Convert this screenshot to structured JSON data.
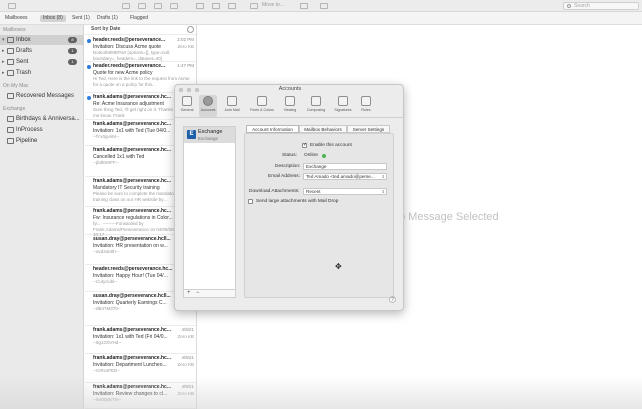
{
  "toolbar": {
    "items": [
      "",
      "",
      "",
      "",
      "",
      "",
      "",
      "Move to...",
      ""
    ],
    "search_placeholder": "Search"
  },
  "favorites": {
    "mailboxes": "Mailboxes",
    "inbox": "Inbox (8)",
    "sent": "Sent (1)",
    "drafts": "Drafts (1)",
    "flagged": "Flagged"
  },
  "sidebar": {
    "section_mailboxes": "Mailboxes",
    "items": [
      {
        "label": "Inbox",
        "badge": "8"
      },
      {
        "label": "Drafts",
        "badge": "1"
      },
      {
        "label": "Sent",
        "badge": "1"
      },
      {
        "label": "Trash",
        "badge": ""
      },
      {
        "label": "Recovered Messages",
        "badge": ""
      }
    ],
    "section_on_my_mac": "On My Mac",
    "section_exchange": "Exchange",
    "exchange_items": [
      {
        "label": "Birthdays & Anniversa..."
      },
      {
        "label": "InProcess"
      },
      {
        "label": "Pipeline"
      }
    ]
  },
  "message_list": {
    "sort_label": "Sort by Date",
    "messages": [
      {
        "from": "header.reeds@perseverance...",
        "date": "2:02 PM",
        "subject": "Invitation: Discuss Acme quote",
        "attachment": "Zero KB",
        "snippet": "NoteofMIMEPart [options=[], type=null, boundary=, headers=, dataset=40]",
        "unread": true
      },
      {
        "from": "header.reeds@perseverance...",
        "date": "1:47 PM",
        "subject": "Quote for new Acme policy",
        "attachment": "",
        "snippet": "Hi Ted, Here is the link to the request from Acme for a quote on a policy for this...",
        "unread": true
      },
      {
        "from": "frank.adams@perseverance.hc...",
        "date": "",
        "subject": "Re: Acme Insurance adjustment",
        "attachment": "",
        "snippet": "Sure thing Ted, I'll get right on it. Thanks for letting me know. Frank",
        "unread": true
      },
      {
        "from": "frank.adams@perseverance.hc...",
        "date": "",
        "subject": "Invitation: 1x1 with Ted (Tue 04/0...",
        "attachment": "",
        "snippet": "--fYx0gvnM--",
        "unread": false
      },
      {
        "from": "frank.adams@perseverance.hc...",
        "date": "",
        "subject": "Cancelled 1x1 with Ted",
        "attachment": "",
        "snippet": "--jbdEMrFF--",
        "unread": false
      },
      {
        "from": "frank.adams@perseverance.hc...",
        "date": "",
        "subject": "Mandatory IT Security training",
        "attachment": "",
        "snippet": "Please be sure to complete the mandatory IT training class on our HR website by...",
        "unread": false
      },
      {
        "from": "frank.adams@perseverance.hc...",
        "date": "",
        "subject": "Fw: Insurance regulations in Color...",
        "attachment": "",
        "snippet": "fyi... ---------Forwarded by Frank.Adams/Perseverance on 04/09/2021 10:17...",
        "unread": false
      },
      {
        "from": "susan.dray@perseverance.hcll...",
        "date": "",
        "subject": "Invitation: HR presentation on w...",
        "attachment": "",
        "snippet": "--avd2ub0h--",
        "unread": false
      },
      {
        "from": "header.reeds@perseverance.hc...",
        "date": "",
        "subject": "Invitation: Happy Hour! (Tue 04/...",
        "attachment": "",
        "snippet": "--CuIyAobl--",
        "unread": false
      },
      {
        "from": "susan.dray@perseverance.hcll...",
        "date": "",
        "subject": "Invitation: Quarterly Earnings C...",
        "attachment": "",
        "snippet": "--dB47M370--",
        "unread": false
      },
      {
        "from": "frank.adams@perseverance.hc...",
        "date": "4/9/21",
        "subject": "Invitation: 1x1 with Ted (Fri 04/0...",
        "attachment": "Zero KB",
        "snippet": "--8g1G0VHd--",
        "unread": false
      },
      {
        "from": "frank.adams@perseverance.hc...",
        "date": "4/9/21",
        "subject": "Invitation: Department Luncheo...",
        "attachment": "Zero KB",
        "snippet": "--CIRcsFED--",
        "unread": false
      },
      {
        "from": "frank.adams@perseverance.hc...",
        "date": "4/9/21",
        "subject": "Invitation: Review changes to cl...",
        "attachment": "Zero KB",
        "snippet": "--5n0DyETm--",
        "unread": false
      }
    ]
  },
  "reading_pane": {
    "empty_text": "o Message Selected"
  },
  "accounts_window": {
    "title": "Accounts",
    "toolbar": [
      {
        "label": "General",
        "icon": "switch-icon"
      },
      {
        "label": "Accounts",
        "icon": "at-sign-icon"
      },
      {
        "label": "Junk Mail",
        "icon": "trash-junk-icon"
      },
      {
        "label": "Fonts & Colors",
        "icon": "font-icon"
      },
      {
        "label": "Viewing",
        "icon": "glasses-icon"
      },
      {
        "label": "Composing",
        "icon": "pen-icon"
      },
      {
        "label": "Signatures",
        "icon": "signature-icon"
      },
      {
        "label": "Rules",
        "icon": "rules-icon"
      }
    ],
    "account": {
      "name": "Exchange",
      "type": "Exchange",
      "icon_letter": "E"
    },
    "tabs": [
      "Account Information",
      "Mailbox Behaviors",
      "Server Settings"
    ],
    "enable_label": "Enable this account",
    "status_label": "Status:",
    "status_value": "Online",
    "description_label": "Description:",
    "description_value": "Exchange",
    "email_label": "Email Address:",
    "email_value": "Ted Amado <ted.amado@perse...",
    "download_label": "Download Attachments:",
    "download_value": "Recent",
    "large_attach_label": "Send large attachments with Mail Drop",
    "plus": "+",
    "minus": "−",
    "help": "?"
  }
}
